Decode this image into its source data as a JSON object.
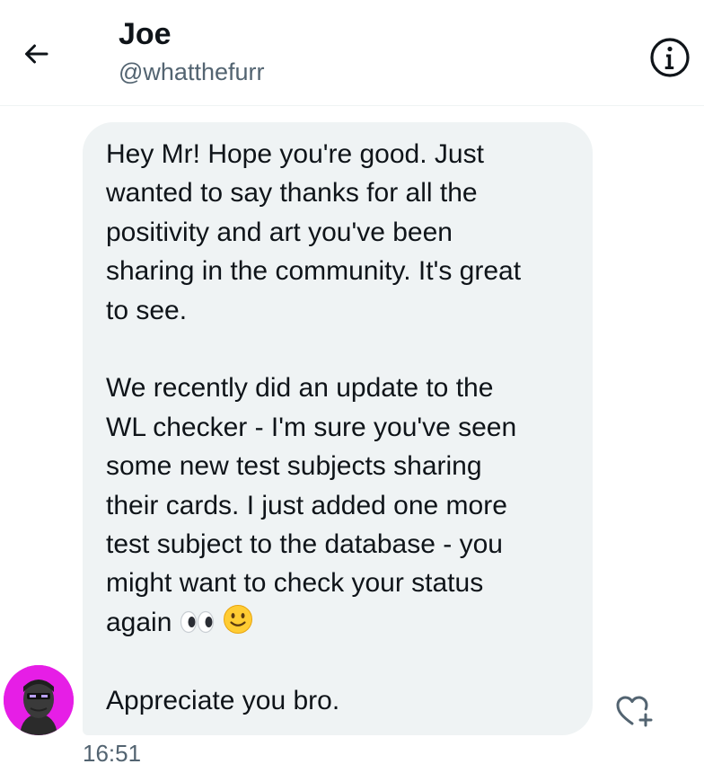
{
  "header": {
    "name": "Joe",
    "handle": "@whatthefurr",
    "back_icon": "arrow-left-icon",
    "info_icon": "info-circle-icon"
  },
  "message": {
    "lines_p1": [
      "Hey Mr! Hope you're good. Just",
      "wanted to say thanks for all the",
      "positivity and art you've been",
      "sharing in the community. It's great",
      "to see."
    ],
    "lines_p2": [
      "We recently did an update to the",
      "WL checker - I'm sure you've seen",
      "some new test subjects sharing",
      "their cards. I just added one more",
      "test subject to the database - you",
      "might want to check your status"
    ],
    "last_line_prefix": "again",
    "emojis": [
      "eyes-emoji",
      "slightly-smiling-face-emoji"
    ],
    "closing": "Appreciate you bro.",
    "timestamp": "16:51",
    "react_icon": "heart-plus-icon"
  },
  "colors": {
    "bubble_bg": "#eff3f4",
    "secondary_text": "#536471",
    "primary_text": "#0f1419",
    "avatar_bg": "#e61ee6"
  }
}
